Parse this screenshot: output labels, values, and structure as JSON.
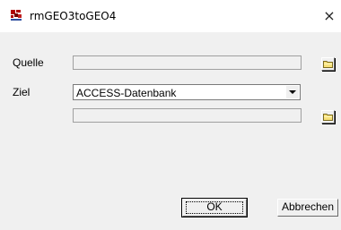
{
  "window": {
    "title": "rmGEO3toGEO4",
    "icon": "app-icon",
    "close_glyph": "×"
  },
  "form": {
    "source_label": "Quelle",
    "source_value": "",
    "target_label": "Ziel",
    "target_type_selected": "ACCESS-Datenbank",
    "target_value": ""
  },
  "buttons": {
    "ok_label": "OK",
    "cancel_label": "Abbrechen"
  }
}
